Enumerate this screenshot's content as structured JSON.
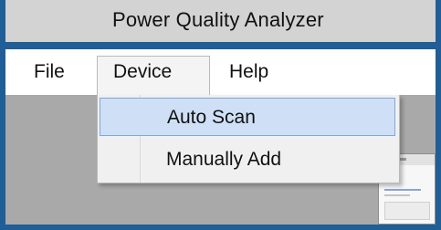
{
  "window": {
    "title": "Power Quality Analyzer"
  },
  "menubar": {
    "items": [
      {
        "label": "File"
      },
      {
        "label": "Device"
      },
      {
        "label": "Help"
      }
    ],
    "open_menu": "Device"
  },
  "device_menu": {
    "items": [
      {
        "label": "Auto Scan",
        "highlighted": true
      },
      {
        "label": "Manually Add",
        "highlighted": false
      }
    ]
  },
  "colors": {
    "frame_border": "#1f5e96",
    "title_background": "#d3d3d3",
    "menu_background": "#ffffff",
    "workspace_background": "#a9a9a9",
    "highlight_background": "#cfe0f6",
    "highlight_border": "#7fa8da"
  }
}
